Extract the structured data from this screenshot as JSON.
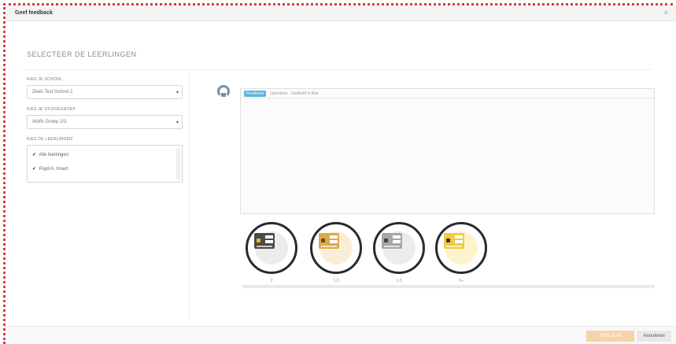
{
  "window": {
    "title": "Geef feedback",
    "close_glyph": "×"
  },
  "page": {
    "heading": "SELECTEER DE LEERLINGEN"
  },
  "filters": {
    "school_label": "KIES JE SCHOOL",
    "school_value": "Zeeb Test School 2",
    "group_label": "KIES JE STUDIEGROEP",
    "group_value": "Wolfs Groep 2/3",
    "students_label": "KIES DE LEERLINGEN",
    "students": [
      {
        "label": "Alle leerlingen",
        "checked": true
      },
      {
        "label": "Pupil A. Insert",
        "checked": true
      }
    ]
  },
  "composer": {
    "tag": "Feedback",
    "placeholder": "Openbaar · Gedeeld in klas"
  },
  "cards": [
    {
      "label": "0",
      "color": "#4a4a4a",
      "chip": "#e8c21d",
      "bg": "#ececec"
    },
    {
      "label": "1-5",
      "color": "#e0a94a",
      "chip": "#6b4a15",
      "bg": "#fbeed8"
    },
    {
      "label": "1-5",
      "color": "#a6a6a6",
      "chip": "#444444",
      "bg": "#ececec"
    },
    {
      "label": "5+",
      "color": "#f0cc3a",
      "chip": "#333333",
      "bg": "#fdf3cd"
    }
  ],
  "actions": {
    "save": "OPSLAAN",
    "cancel": "Annuleren"
  },
  "colors": {
    "frame_border": "#e03a3a",
    "accent": "#5bb5e0"
  }
}
